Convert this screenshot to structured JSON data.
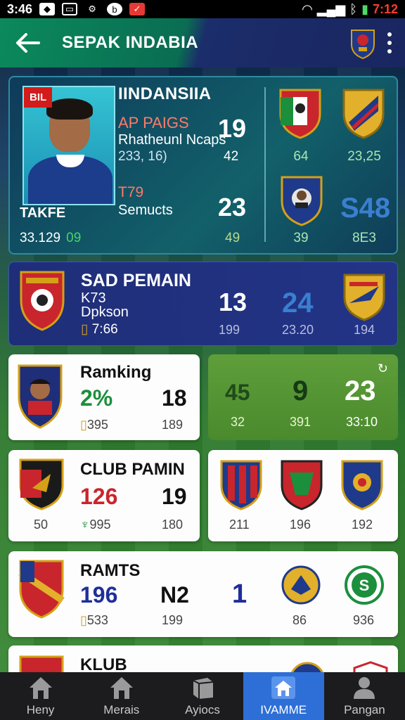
{
  "status_bar": {
    "time": "3:46",
    "battery_time": "7:12"
  },
  "app_bar": {
    "title": "SEPAK INDABIA"
  },
  "player_card": {
    "badge": "BIL",
    "name": "TAKFE",
    "number": "33.129",
    "number_green": "09",
    "country": "IINDANSIIA",
    "stat1_label": "AP PAIGS",
    "stat1_sub": "Rhatheunl Ncaps",
    "stat1_detail": "233, 16)",
    "stat1_big": "19",
    "stat1_small": "42",
    "stat2_label": "T79",
    "stat2_sub": "Semucts",
    "stat2_big": "23",
    "stat2_small": "49",
    "clubs": [
      {
        "value": "64"
      },
      {
        "value": "23,25"
      },
      {
        "value": "39"
      },
      {
        "value": "8E3"
      }
    ],
    "big_blue": "S48"
  },
  "team_card": {
    "title": "SAD PEMAIN",
    "line1": "K73",
    "line2": "Dpkson",
    "line3": "7:66",
    "big1": "13",
    "big2": "24",
    "small1": "199",
    "small2": "23.20",
    "small3": "194"
  },
  "ranking_card": {
    "title": "Ramking",
    "pct": "2%",
    "big": "18",
    "small1": "395",
    "small2": "189"
  },
  "green_card": {
    "v1": "45",
    "v2": "9",
    "v3": "23",
    "s1": "32",
    "s2": "391",
    "s3": "33:10"
  },
  "club_card": {
    "title": "CLUB PAMIN",
    "red_val": "126",
    "big": "19",
    "small1": "50",
    "small2": "995",
    "small3": "180"
  },
  "club_crests_card": {
    "values": [
      "211",
      "196",
      "192"
    ]
  },
  "ramts_card": {
    "title": "RAMTS",
    "blue_val": "196",
    "big": "N2",
    "small1": "533",
    "small2": "199",
    "big_blue": "1",
    "values": [
      "86",
      "936"
    ]
  },
  "klub_card": {
    "title": "KLUB"
  },
  "nav": [
    {
      "label": "Heny",
      "icon": "home-icon"
    },
    {
      "label": "Merais",
      "icon": "home-icon"
    },
    {
      "label": "Ayiocs",
      "icon": "box-icon"
    },
    {
      "label": "IVAMME",
      "icon": "home-icon"
    },
    {
      "label": "Pangan",
      "icon": "person-icon"
    }
  ],
  "colors": {
    "accent": "#2d6fd6",
    "green": "#47d36b",
    "red": "#c9252c",
    "navy": "#1f2e78"
  }
}
